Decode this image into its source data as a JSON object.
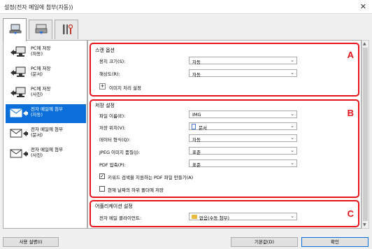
{
  "window": {
    "title": "설정(전자 메일에 첨부(자동))",
    "close_glyph": "✕"
  },
  "tabs": [
    {
      "name": "scan-from-computer-icon"
    },
    {
      "name": "scan-from-panel-icon"
    },
    {
      "name": "general-settings-tools-icon"
    }
  ],
  "left_items": [
    {
      "label": "PC에 저장\n(자동)",
      "icon": "save-to-pc-icon"
    },
    {
      "label": "PC에 저장\n(문서)",
      "icon": "save-to-pc-icon"
    },
    {
      "label": "PC에 저장\n(사진)",
      "icon": "save-to-pc-icon"
    },
    {
      "label": "전자 메일에 첨부\n(자동)",
      "icon": "attach-email-icon",
      "selected": true
    },
    {
      "label": "전자 메일에 첨부\n(문서)",
      "icon": "attach-email-icon"
    },
    {
      "label": "전자 메일에 첨부\n(사진)",
      "icon": "attach-email-icon"
    }
  ],
  "scan_options": {
    "title": "스캔 옵션",
    "letter": "A",
    "paper_size_label": "용지 크기(S):",
    "paper_size_value": "자동",
    "resolution_label": "해상도(R):",
    "resolution_value": "자동",
    "image_processing_label": "이미지 처리 설정",
    "expand_glyph": "+"
  },
  "save_settings": {
    "title": "저장 설정",
    "letter": "B",
    "file_name_label": "파일 이름(E):",
    "file_name_value": "IMG",
    "save_in_label": "저장 위치(V):",
    "save_in_value": "문서",
    "data_format_label": "데이터 형식(Q):",
    "data_format_value": "자동",
    "jpeg_quality_label": "JPEG 이미지 품질(J):",
    "jpeg_quality_value": "표준",
    "pdf_compression_label": "PDF 압축(P):",
    "pdf_compression_value": "표준",
    "keyword_search_label": "키워드 검색을 지원하는 PDF 파일 만들기(A)",
    "keyword_search_checked": true,
    "subfolder_label": "현재 날짜의 하위 폴더에 저장",
    "subfolder_checked": false,
    "check_glyph": "✓"
  },
  "app_settings": {
    "title": "어플리케이션 설정",
    "letter": "C",
    "email_client_label": "전자 메일 클라이언트:",
    "email_client_value": "없음(수동 첨부)"
  },
  "footer": {
    "instructions_label": "사용 설명(I)",
    "defaults_label": "기본값(D)",
    "ok_label": "확인"
  },
  "colors": {
    "accent_red": "#e8121b",
    "selection_blue": "#0a6fd9"
  }
}
